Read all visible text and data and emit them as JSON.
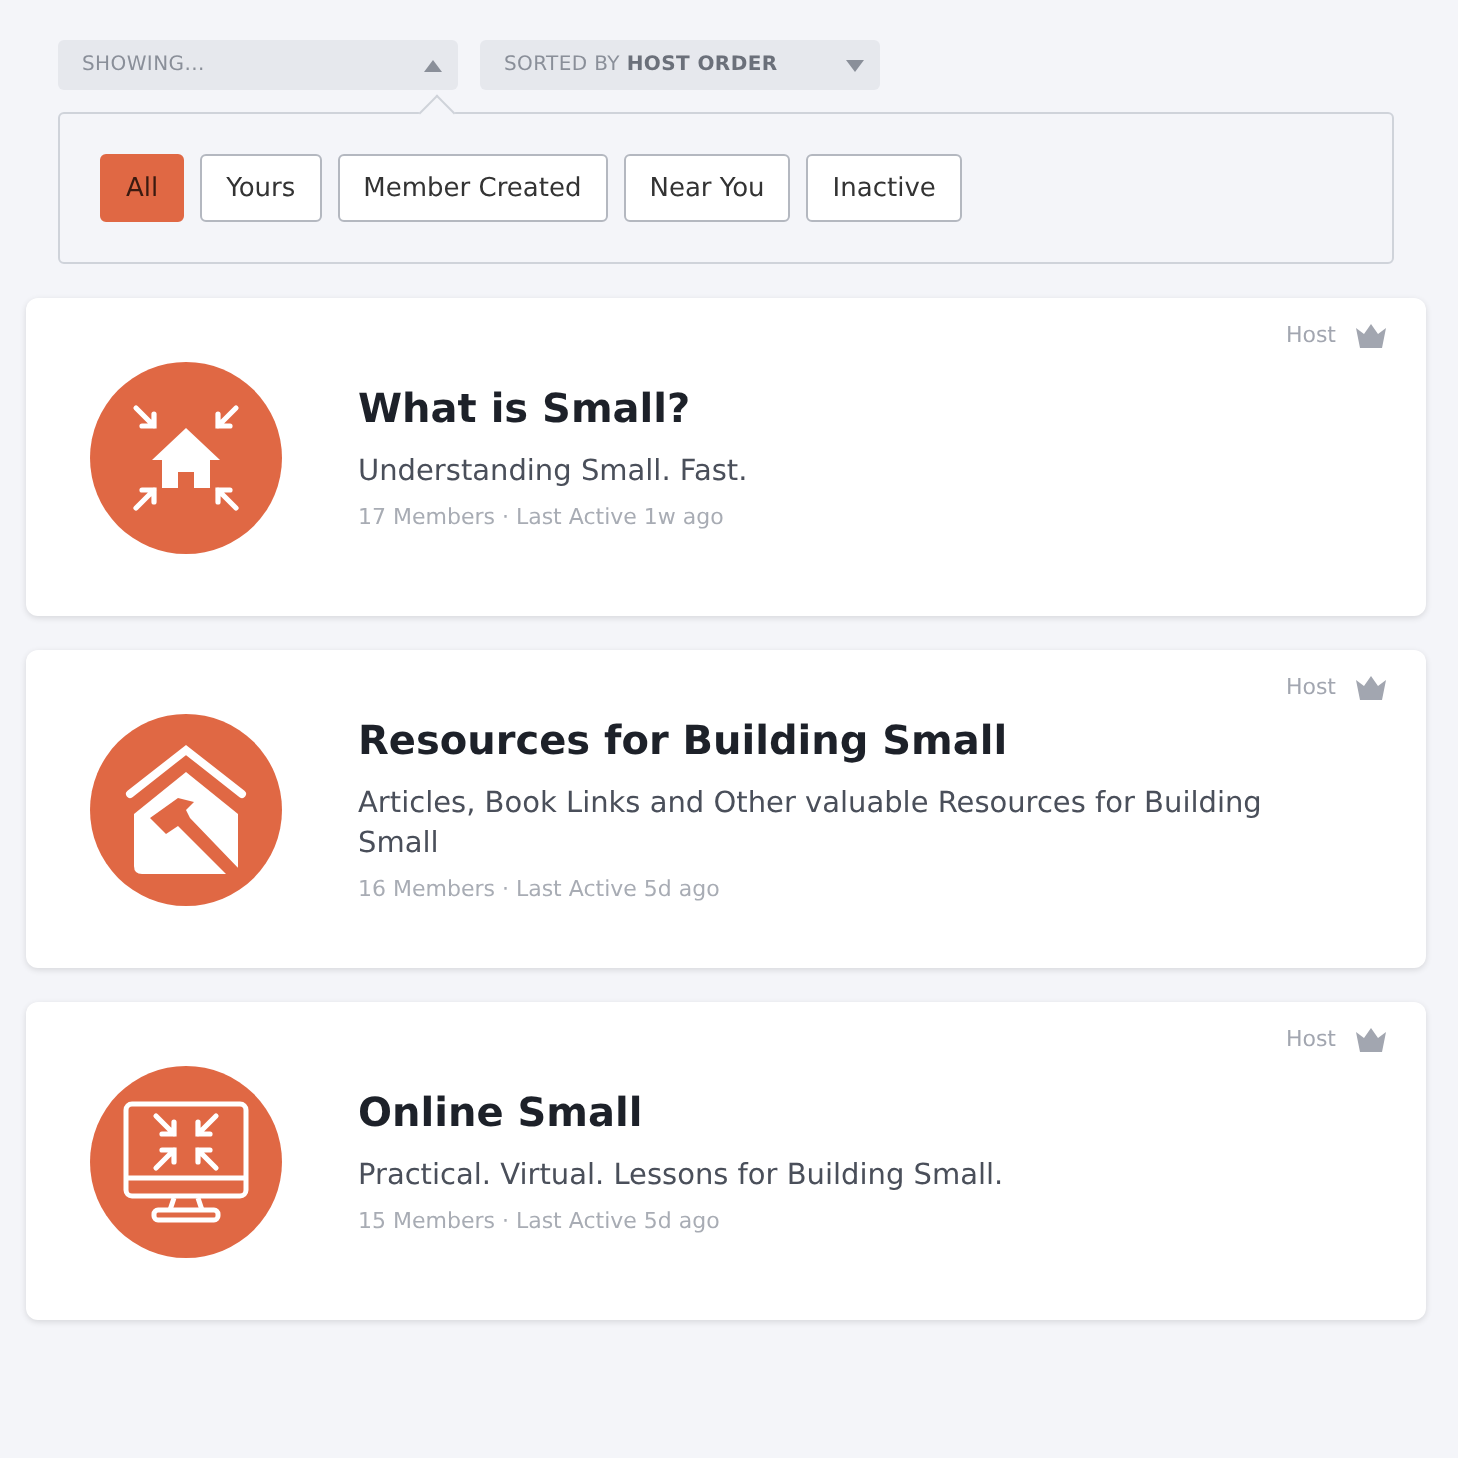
{
  "filters": {
    "showing": {
      "label": "SHOWING...",
      "expanded": true
    },
    "sort": {
      "label": "SORTED BY **HOST ORDER**",
      "expanded": false
    }
  },
  "filter_options": [
    {
      "label": "All",
      "selected": true
    },
    {
      "label": "Yours",
      "selected": false
    },
    {
      "label": "Member Created",
      "selected": false
    },
    {
      "label": "Near You",
      "selected": false
    },
    {
      "label": "Inactive",
      "selected": false
    }
  ],
  "groups": [
    {
      "title": "What is Small?",
      "description": "Understanding Small. Fast.",
      "meta": "17 Members · Last Active 1w ago",
      "role": "Host"
    },
    {
      "title": "Resources for Building Small",
      "description": "Articles, Book Links and Other valuable Resources for Building Small",
      "meta": "16 Members · Last Active 5d ago",
      "role": "Host"
    },
    {
      "title": "Online Small",
      "description": "Practical. Virtual. Lessons for Building Small.",
      "meta": "15 Members · Last Active 5d ago",
      "role": "Host"
    }
  ]
}
